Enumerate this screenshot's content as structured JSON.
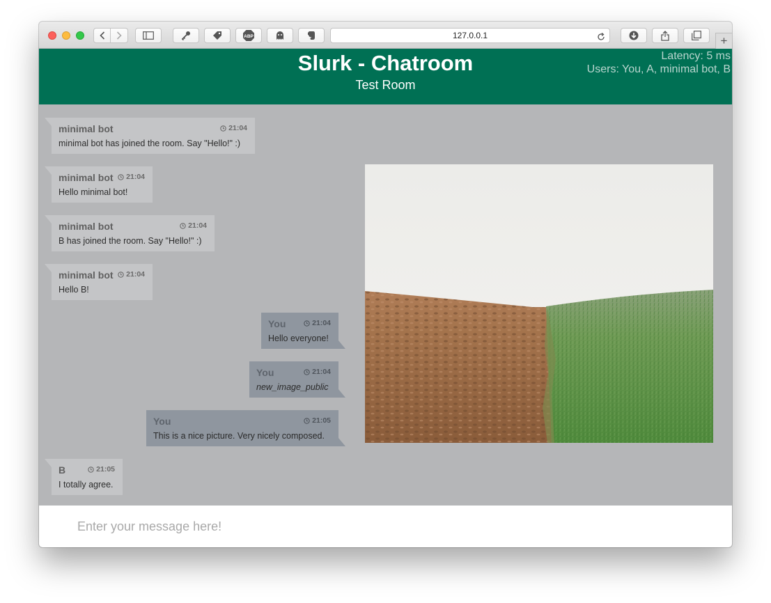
{
  "browser": {
    "url": "127.0.0.1",
    "icons": [
      "back-icon",
      "forward-icon",
      "sidebar-icon",
      "key-icon",
      "tag-icon",
      "adblock-icon",
      "ghost-icon",
      "evernote-icon",
      "reload-icon",
      "download-icon",
      "share-icon",
      "tabs-icon",
      "new-tab-icon"
    ],
    "abp_label": "ABP",
    "new_tab_label": "+"
  },
  "header": {
    "title": "Slurk - Chatroom",
    "room": "Test Room",
    "latency": "Latency: 5 ms",
    "users": "Users: You, A, minimal bot, B",
    "background": "#007054"
  },
  "messages": [
    {
      "user": "minimal bot",
      "time": "21:04",
      "text": "minimal bot has joined the room. Say \"Hello!\" :)",
      "own": false
    },
    {
      "user": "minimal bot",
      "time": "21:04",
      "text": "Hello minimal bot!",
      "own": false
    },
    {
      "user": "minimal bot",
      "time": "21:04",
      "text": "B has joined the room. Say \"Hello!\" :)",
      "own": false
    },
    {
      "user": "minimal bot",
      "time": "21:04",
      "text": "Hello B!",
      "own": false
    },
    {
      "user": "You",
      "time": "21:04",
      "text": "Hello everyone!",
      "own": true
    },
    {
      "user": "You",
      "time": "21:04",
      "text": "new_image_public",
      "own": true
    },
    {
      "user": "You",
      "time": "21:05",
      "text": "This is a nice picture. Very nicely composed.",
      "own": true
    },
    {
      "user": "B",
      "time": "21:05",
      "text": "I totally agree.",
      "own": false
    }
  ],
  "image": {
    "description_icon": "field-landscape-image"
  },
  "input": {
    "placeholder": "Enter your message here!",
    "value": ""
  }
}
